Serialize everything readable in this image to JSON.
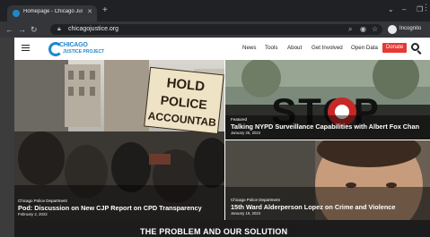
{
  "browser": {
    "tab_title": "Homepage - Chicago Justice Pr",
    "tab_close": "✕",
    "new_tab": "+",
    "url": "chicagojustice.org",
    "profile_label": "Incognito",
    "window_controls": [
      "⌄",
      "–",
      "❐"
    ]
  },
  "site": {
    "logo_line1": "CHICAGO",
    "logo_line2": "JUSTICE PROJECT",
    "nav": [
      "News",
      "Tools",
      "About",
      "Get Involved",
      "Open Data"
    ],
    "donate_label": "Donate"
  },
  "hero": {
    "main": {
      "category": "Chicago Police Department",
      "title": "Pod: Discussion on New CJP Report on CPD Transparency",
      "date": "February 2, 2022",
      "sign_text": [
        "HOLD",
        "POLICE",
        "ACCOUNTAB"
      ]
    },
    "top_right": {
      "category": "Featured",
      "title": "Talking NYPD Surveillance Capabilities with Albert Fox Chan",
      "date": "January 26, 2022",
      "sign_text": "STOP"
    },
    "bottom_right": {
      "category": "Chicago Police Department",
      "title": "15th Ward Alderperson Lopez on Crime and Violence",
      "date": "January 19, 2022"
    }
  },
  "section_heading": "THE PROBLEM AND OUR SOLUTION"
}
